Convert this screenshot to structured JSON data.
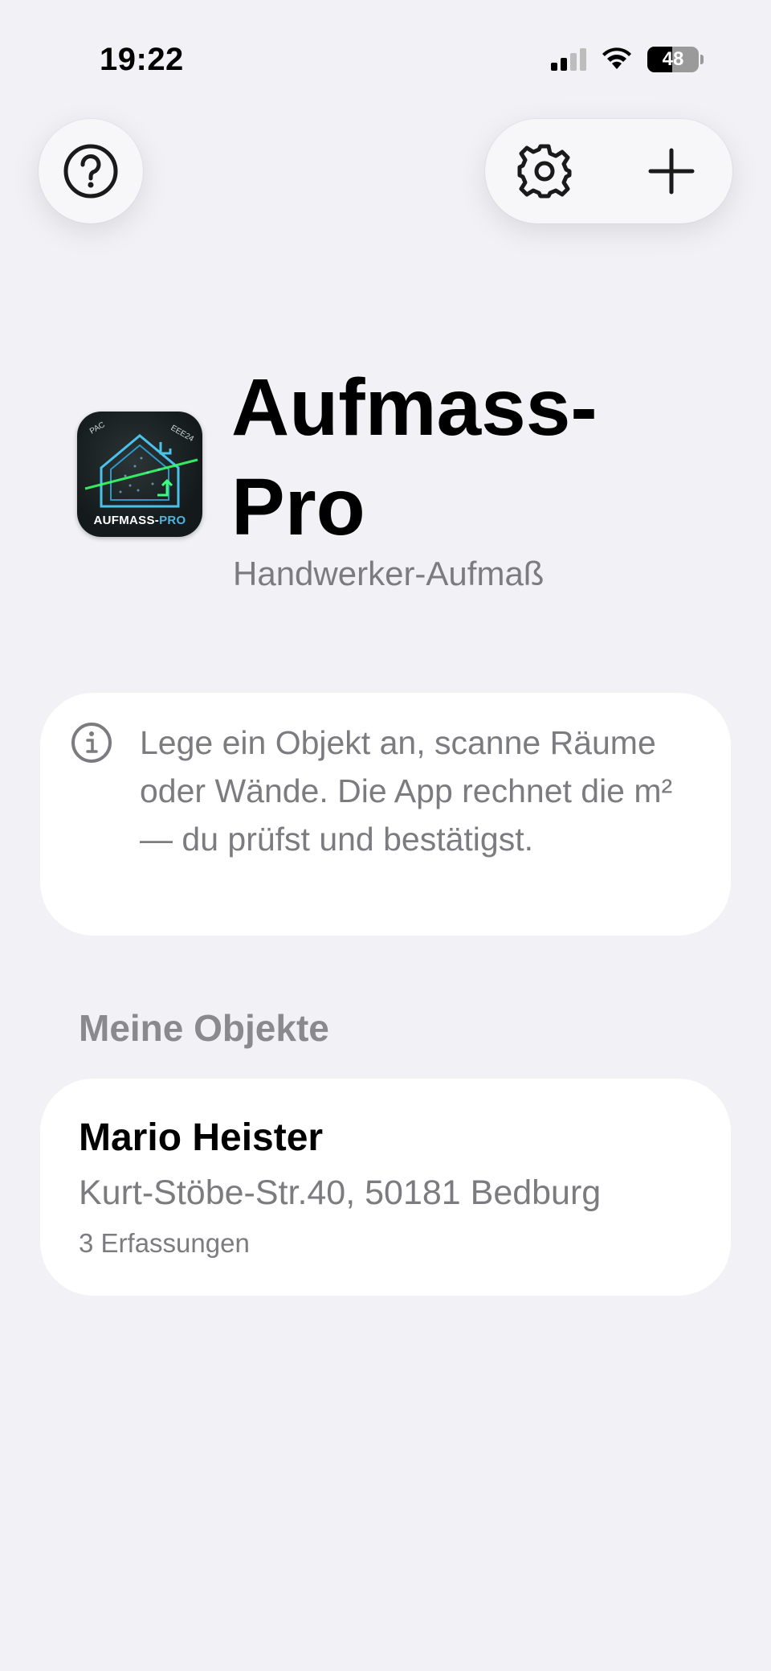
{
  "status_bar": {
    "time": "19:22",
    "battery": "48",
    "battery_level_percent": 48,
    "icons": [
      "cellular-signal-icon",
      "wifi-icon",
      "battery-icon"
    ]
  },
  "toolbar": {
    "help_icon": "question-circle-icon",
    "settings_icon": "gear-icon",
    "add_icon": "plus-icon"
  },
  "header": {
    "title": "Aufmass-Pro",
    "subtitle": "Handwerker-Aufmaß",
    "app_icon_label_main": "AUFMASS-",
    "app_icon_label_accent": "PRO",
    "app_icon_corner_left": "PAC",
    "app_icon_corner_right": "EEE24"
  },
  "info_card": {
    "icon": "info-circle-icon",
    "text": "Lege ein Objekt an, scanne Räume oder Wände. Die App rechnet die m² — du prüfst und bestätigst."
  },
  "objects": {
    "section_title": "Meine Objekte",
    "items": [
      {
        "name": "Mario Heister",
        "address": "Kurt-Stöbe-Str.40, 50181 Bedburg",
        "count": "3 Erfassungen"
      }
    ]
  },
  "colors": {
    "background": "#f1f1f6",
    "card": "#ffffff",
    "secondary_text": "#7c7c80",
    "section_title": "#8a8a8e",
    "icon_accent": "#4fd3ff"
  }
}
